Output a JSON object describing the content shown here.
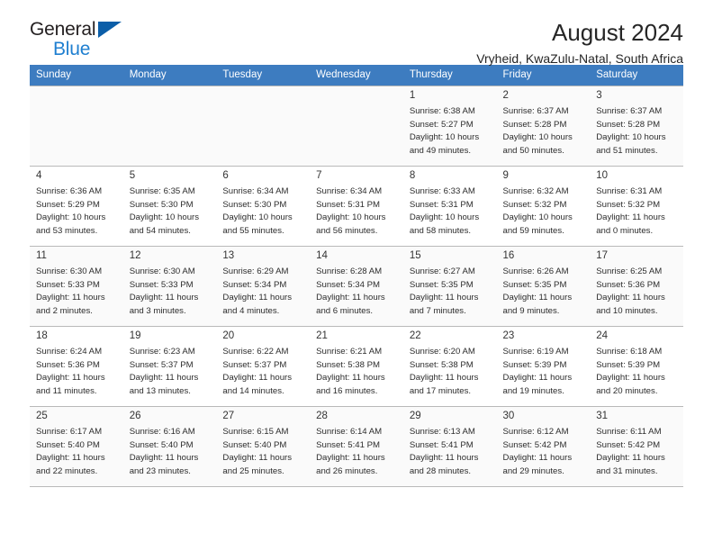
{
  "brand": {
    "name_top": "General",
    "name_bottom": "Blue",
    "flag_icon": "triangle-flag-icon"
  },
  "header": {
    "title": "August 2024",
    "location": "Vryheid, KwaZulu-Natal, South Africa"
  },
  "colors": {
    "header_row": "#3d7cc0",
    "brand_blue": "#1f7fd0",
    "flag_blue": "#0b5ea8",
    "row_alt": "#fafafa",
    "grid_line": "#b9b9b9"
  },
  "weekdays": [
    "Sunday",
    "Monday",
    "Tuesday",
    "Wednesday",
    "Thursday",
    "Friday",
    "Saturday"
  ],
  "labels": {
    "sunrise_prefix": "Sunrise: ",
    "sunset_prefix": "Sunset: ",
    "daylight_prefix": "Daylight: "
  },
  "weeks": [
    [
      {
        "day": ""
      },
      {
        "day": ""
      },
      {
        "day": ""
      },
      {
        "day": ""
      },
      {
        "day": "1",
        "sunrise": "Sunrise: 6:38 AM",
        "sunset": "Sunset: 5:27 PM",
        "daylight1": "Daylight: 10 hours",
        "daylight2": "and 49 minutes."
      },
      {
        "day": "2",
        "sunrise": "Sunrise: 6:37 AM",
        "sunset": "Sunset: 5:28 PM",
        "daylight1": "Daylight: 10 hours",
        "daylight2": "and 50 minutes."
      },
      {
        "day": "3",
        "sunrise": "Sunrise: 6:37 AM",
        "sunset": "Sunset: 5:28 PM",
        "daylight1": "Daylight: 10 hours",
        "daylight2": "and 51 minutes."
      }
    ],
    [
      {
        "day": "4",
        "sunrise": "Sunrise: 6:36 AM",
        "sunset": "Sunset: 5:29 PM",
        "daylight1": "Daylight: 10 hours",
        "daylight2": "and 53 minutes."
      },
      {
        "day": "5",
        "sunrise": "Sunrise: 6:35 AM",
        "sunset": "Sunset: 5:30 PM",
        "daylight1": "Daylight: 10 hours",
        "daylight2": "and 54 minutes."
      },
      {
        "day": "6",
        "sunrise": "Sunrise: 6:34 AM",
        "sunset": "Sunset: 5:30 PM",
        "daylight1": "Daylight: 10 hours",
        "daylight2": "and 55 minutes."
      },
      {
        "day": "7",
        "sunrise": "Sunrise: 6:34 AM",
        "sunset": "Sunset: 5:31 PM",
        "daylight1": "Daylight: 10 hours",
        "daylight2": "and 56 minutes."
      },
      {
        "day": "8",
        "sunrise": "Sunrise: 6:33 AM",
        "sunset": "Sunset: 5:31 PM",
        "daylight1": "Daylight: 10 hours",
        "daylight2": "and 58 minutes."
      },
      {
        "day": "9",
        "sunrise": "Sunrise: 6:32 AM",
        "sunset": "Sunset: 5:32 PM",
        "daylight1": "Daylight: 10 hours",
        "daylight2": "and 59 minutes."
      },
      {
        "day": "10",
        "sunrise": "Sunrise: 6:31 AM",
        "sunset": "Sunset: 5:32 PM",
        "daylight1": "Daylight: 11 hours",
        "daylight2": "and 0 minutes."
      }
    ],
    [
      {
        "day": "11",
        "sunrise": "Sunrise: 6:30 AM",
        "sunset": "Sunset: 5:33 PM",
        "daylight1": "Daylight: 11 hours",
        "daylight2": "and 2 minutes."
      },
      {
        "day": "12",
        "sunrise": "Sunrise: 6:30 AM",
        "sunset": "Sunset: 5:33 PM",
        "daylight1": "Daylight: 11 hours",
        "daylight2": "and 3 minutes."
      },
      {
        "day": "13",
        "sunrise": "Sunrise: 6:29 AM",
        "sunset": "Sunset: 5:34 PM",
        "daylight1": "Daylight: 11 hours",
        "daylight2": "and 4 minutes."
      },
      {
        "day": "14",
        "sunrise": "Sunrise: 6:28 AM",
        "sunset": "Sunset: 5:34 PM",
        "daylight1": "Daylight: 11 hours",
        "daylight2": "and 6 minutes."
      },
      {
        "day": "15",
        "sunrise": "Sunrise: 6:27 AM",
        "sunset": "Sunset: 5:35 PM",
        "daylight1": "Daylight: 11 hours",
        "daylight2": "and 7 minutes."
      },
      {
        "day": "16",
        "sunrise": "Sunrise: 6:26 AM",
        "sunset": "Sunset: 5:35 PM",
        "daylight1": "Daylight: 11 hours",
        "daylight2": "and 9 minutes."
      },
      {
        "day": "17",
        "sunrise": "Sunrise: 6:25 AM",
        "sunset": "Sunset: 5:36 PM",
        "daylight1": "Daylight: 11 hours",
        "daylight2": "and 10 minutes."
      }
    ],
    [
      {
        "day": "18",
        "sunrise": "Sunrise: 6:24 AM",
        "sunset": "Sunset: 5:36 PM",
        "daylight1": "Daylight: 11 hours",
        "daylight2": "and 11 minutes."
      },
      {
        "day": "19",
        "sunrise": "Sunrise: 6:23 AM",
        "sunset": "Sunset: 5:37 PM",
        "daylight1": "Daylight: 11 hours",
        "daylight2": "and 13 minutes."
      },
      {
        "day": "20",
        "sunrise": "Sunrise: 6:22 AM",
        "sunset": "Sunset: 5:37 PM",
        "daylight1": "Daylight: 11 hours",
        "daylight2": "and 14 minutes."
      },
      {
        "day": "21",
        "sunrise": "Sunrise: 6:21 AM",
        "sunset": "Sunset: 5:38 PM",
        "daylight1": "Daylight: 11 hours",
        "daylight2": "and 16 minutes."
      },
      {
        "day": "22",
        "sunrise": "Sunrise: 6:20 AM",
        "sunset": "Sunset: 5:38 PM",
        "daylight1": "Daylight: 11 hours",
        "daylight2": "and 17 minutes."
      },
      {
        "day": "23",
        "sunrise": "Sunrise: 6:19 AM",
        "sunset": "Sunset: 5:39 PM",
        "daylight1": "Daylight: 11 hours",
        "daylight2": "and 19 minutes."
      },
      {
        "day": "24",
        "sunrise": "Sunrise: 6:18 AM",
        "sunset": "Sunset: 5:39 PM",
        "daylight1": "Daylight: 11 hours",
        "daylight2": "and 20 minutes."
      }
    ],
    [
      {
        "day": "25",
        "sunrise": "Sunrise: 6:17 AM",
        "sunset": "Sunset: 5:40 PM",
        "daylight1": "Daylight: 11 hours",
        "daylight2": "and 22 minutes."
      },
      {
        "day": "26",
        "sunrise": "Sunrise: 6:16 AM",
        "sunset": "Sunset: 5:40 PM",
        "daylight1": "Daylight: 11 hours",
        "daylight2": "and 23 minutes."
      },
      {
        "day": "27",
        "sunrise": "Sunrise: 6:15 AM",
        "sunset": "Sunset: 5:40 PM",
        "daylight1": "Daylight: 11 hours",
        "daylight2": "and 25 minutes."
      },
      {
        "day": "28",
        "sunrise": "Sunrise: 6:14 AM",
        "sunset": "Sunset: 5:41 PM",
        "daylight1": "Daylight: 11 hours",
        "daylight2": "and 26 minutes."
      },
      {
        "day": "29",
        "sunrise": "Sunrise: 6:13 AM",
        "sunset": "Sunset: 5:41 PM",
        "daylight1": "Daylight: 11 hours",
        "daylight2": "and 28 minutes."
      },
      {
        "day": "30",
        "sunrise": "Sunrise: 6:12 AM",
        "sunset": "Sunset: 5:42 PM",
        "daylight1": "Daylight: 11 hours",
        "daylight2": "and 29 minutes."
      },
      {
        "day": "31",
        "sunrise": "Sunrise: 6:11 AM",
        "sunset": "Sunset: 5:42 PM",
        "daylight1": "Daylight: 11 hours",
        "daylight2": "and 31 minutes."
      }
    ]
  ]
}
